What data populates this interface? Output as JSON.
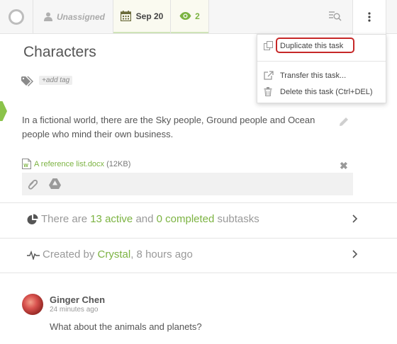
{
  "topbar": {
    "assignee_label": "Unassigned",
    "due_date": "Sep 20",
    "watchers_count": "2"
  },
  "task": {
    "title": "Characters",
    "add_tag_label": "+add tag",
    "description": "In a fictional world, there are the Sky people, Ground people and Ocean people who mind their own business.",
    "attachment": {
      "name": "A reference list.docx",
      "size": "(12KB)"
    }
  },
  "subtasks": {
    "prefix": "There are",
    "active": "13 active",
    "middle": "and",
    "completed": "0 completed",
    "suffix": "subtasks"
  },
  "activity": {
    "prefix": "Created by",
    "author": "Crystal",
    "time": ", 8 hours ago"
  },
  "comment": {
    "author": "Ginger Chen",
    "time": "24 minutes ago",
    "text": "What about the animals and planets?"
  },
  "menu": {
    "items": [
      {
        "label": "Duplicate this task",
        "icon": "copy-icon"
      },
      {
        "label": "Transfer this task...",
        "icon": "external-link-icon"
      },
      {
        "label": "Delete this task (Ctrl+DEL)",
        "icon": "trash-icon"
      }
    ]
  },
  "colors": {
    "accent_green": "#7cb342",
    "highlight_red": "#c62828"
  }
}
